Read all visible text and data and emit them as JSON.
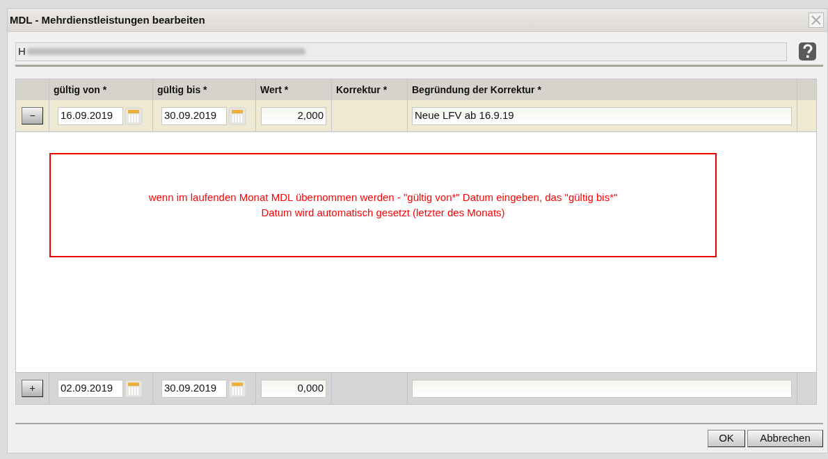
{
  "window": {
    "title": "MDL - Mehrdienstleistungen bearbeiten"
  },
  "person_field": {
    "value": "H"
  },
  "table": {
    "columns": [
      "gültig von *",
      "gültig bis *",
      "Wert *",
      "Korrektur *",
      "Begründung der Korrektur *"
    ],
    "rows": [
      {
        "kind": "existing",
        "action": "−",
        "from": "16.09.2019",
        "to": "30.09.2019",
        "value": "2,000",
        "reason": "Neue LFV ab 16.9.19"
      }
    ],
    "new_row": {
      "kind": "new",
      "action": "+",
      "from": "02.09.2019",
      "to": "30.09.2019",
      "value": "0,000"
    }
  },
  "annotation": {
    "text": "wenn im laufenden Monat MDL übernommen werden - \"gültig von*\" Datum eingeben, das \"gültig bis*\" Datum wird automatisch gesetzt (letzter des Monats)"
  },
  "buttons": [
    "OK",
    "Abbrechen"
  ]
}
